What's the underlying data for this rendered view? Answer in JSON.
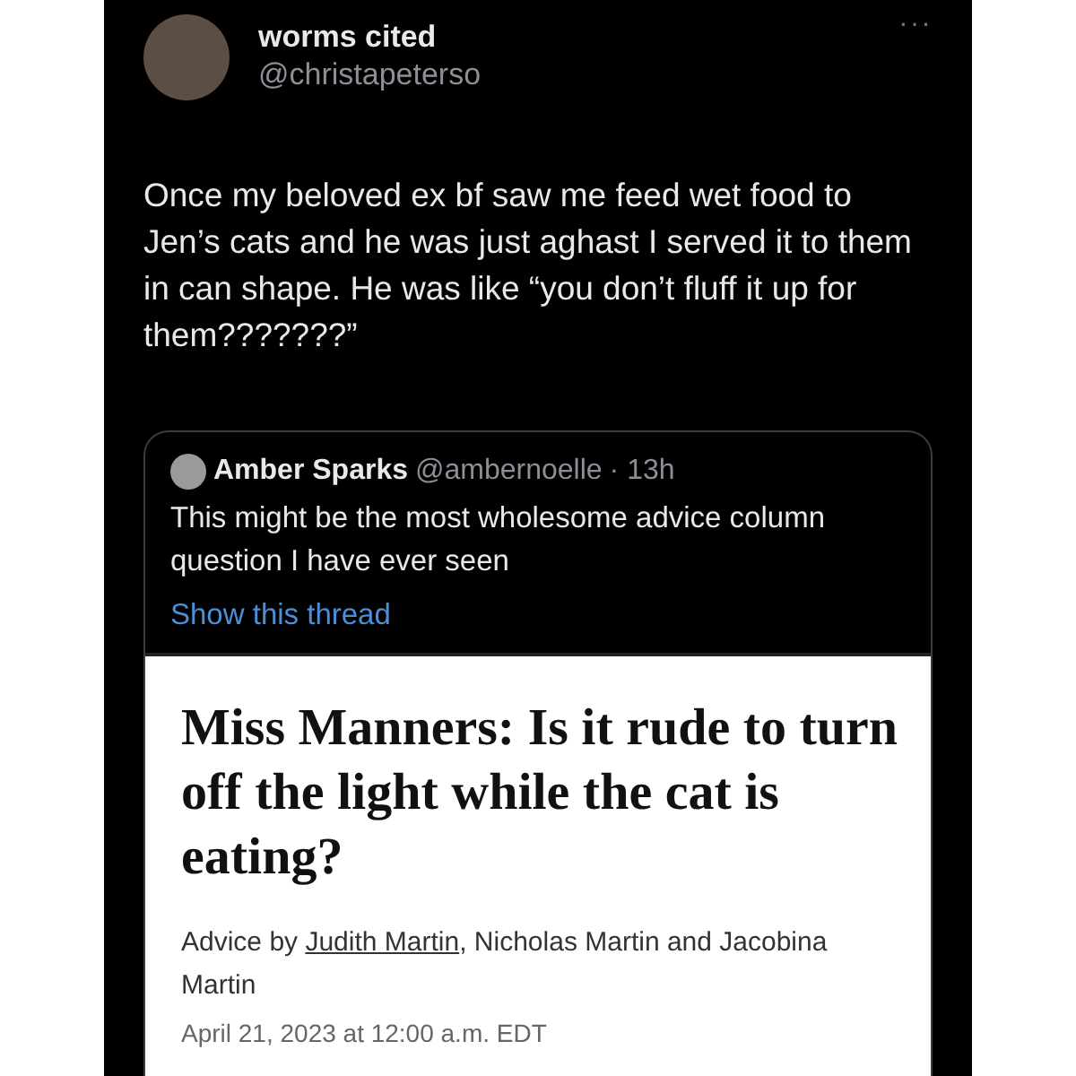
{
  "tweet": {
    "display_name": "worms cited",
    "handle": "@christapeterso",
    "more": "···",
    "text": "Once my beloved ex bf saw me feed wet food to Jen’s cats and he was just aghast I served it to them in can shape. He was like “you don’t fluff it up for them???????”",
    "quote": {
      "display_name": "Amber Sparks",
      "handle": "@ambernoelle",
      "time": "· 13h",
      "text": "This might be the most wholesome advice column question I have ever seen",
      "thread_link": "Show this thread",
      "article": {
        "headline": "Miss Manners: Is it rude to turn off the light while the cat is eating?",
        "byline_prefix": "Advice by ",
        "byline_link": "Judith Martin",
        "byline_suffix": ", Nicholas Martin and Jacobina Martin",
        "date": "April 21, 2023 at 12:00 a.m. EDT"
      }
    }
  }
}
